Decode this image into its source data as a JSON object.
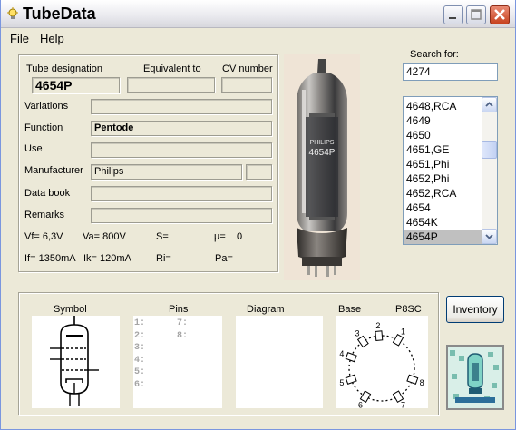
{
  "window": {
    "title": "TubeData"
  },
  "menu": {
    "items": [
      {
        "label": "File"
      },
      {
        "label": "Help"
      }
    ]
  },
  "search": {
    "label": "Search for:",
    "value": "4274"
  },
  "list": {
    "items": [
      "4648,RCA",
      "4649",
      "4650",
      "4651,GE",
      "4651,Phi",
      "4652,Phi",
      "4652,RCA",
      "4654",
      "4654K",
      "4654P"
    ],
    "selected": "4654P"
  },
  "details": {
    "designation_label": "Tube designation",
    "designation_value": "4654P",
    "equivalent_label": "Equivalent to",
    "equivalent_value": "",
    "cv_label": "CV number",
    "cv_value": "",
    "variations_label": "Variations",
    "variations_value": "",
    "function_label": "Function",
    "function_value": "Pentode",
    "use_label": "Use",
    "use_value": "",
    "manufacturer_label": "Manufacturer",
    "manufacturer_value": "Philips",
    "manufacturer_extra": "",
    "databook_label": "Data book",
    "databook_value": "",
    "remarks_label": "Remarks",
    "remarks_value": ""
  },
  "params": {
    "vf": "Vf= 6,3V",
    "va": "Va= 800V",
    "s": "S=",
    "mu": "µ=",
    "mu_value": "0",
    "if": "If= 1350mA",
    "ik": "Ik=  120mA",
    "ri": "Ri=",
    "pa": "Pa="
  },
  "tube_photo": {
    "print_line1": "PHILIPS",
    "print_line2": "4654P"
  },
  "bottom": {
    "symbol_label": "Symbol",
    "pins_label": "Pins",
    "diagram_label": "Diagram",
    "base_label": "Base",
    "base_type": "P8SC",
    "pins_col1": [
      "1:",
      "2:",
      "3:",
      "4:",
      "5:",
      "6:"
    ],
    "pins_col2": [
      "7:",
      "8:"
    ],
    "base_pin_numbers": [
      "1",
      "2",
      "3",
      "4",
      "5",
      "6",
      "7",
      "8"
    ]
  },
  "buttons": {
    "inventory": "Inventory"
  },
  "icons": {
    "app": "lightbulb-icon",
    "minimize": "minimize-icon",
    "maximize": "maximize-icon",
    "close": "close-icon",
    "scroll_up": "chevron-up-icon",
    "scroll_down": "chevron-down-icon",
    "logo": "tube-logo-icon"
  }
}
